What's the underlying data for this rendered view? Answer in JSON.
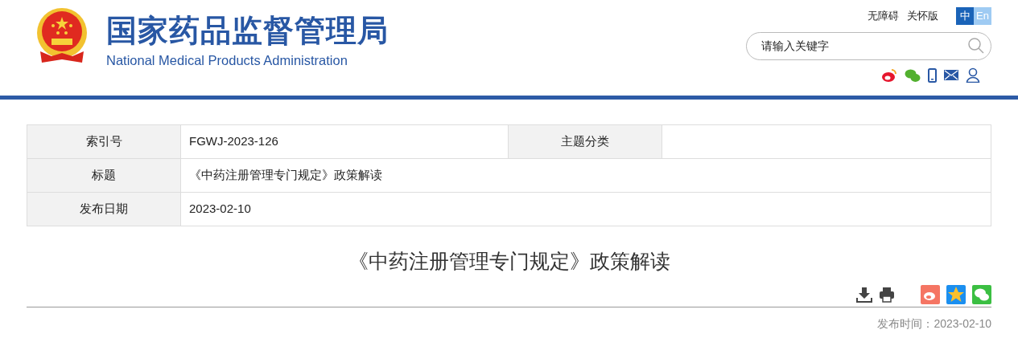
{
  "header": {
    "site_title": "国家药品监督管理局",
    "site_subtitle": "National Medical Products Administration",
    "top_links": [
      "无障碍",
      "关怀版"
    ],
    "languages": [
      {
        "label": "中",
        "selected": true
      },
      {
        "label": "En",
        "selected": false
      }
    ],
    "search": {
      "placeholder": "请输入关键字"
    }
  },
  "info_table": {
    "rows": [
      {
        "cells": [
          {
            "kind": "label",
            "text": "索引号"
          },
          {
            "kind": "value",
            "text": "FGWJ-2023-126"
          },
          {
            "kind": "label",
            "text": "主题分类"
          },
          {
            "kind": "empty"
          }
        ]
      },
      {
        "cells": [
          {
            "kind": "label",
            "text": "标题"
          },
          {
            "kind": "wide",
            "text": "《中药注册管理专门规定》政策解读"
          }
        ]
      },
      {
        "cells": [
          {
            "kind": "label",
            "text": "发布日期"
          },
          {
            "kind": "wide",
            "text": "2023-02-10"
          }
        ]
      }
    ]
  },
  "article": {
    "title": "《中药注册管理专门规定》政策解读",
    "publish_time": "发布时间：2023-02-10"
  }
}
